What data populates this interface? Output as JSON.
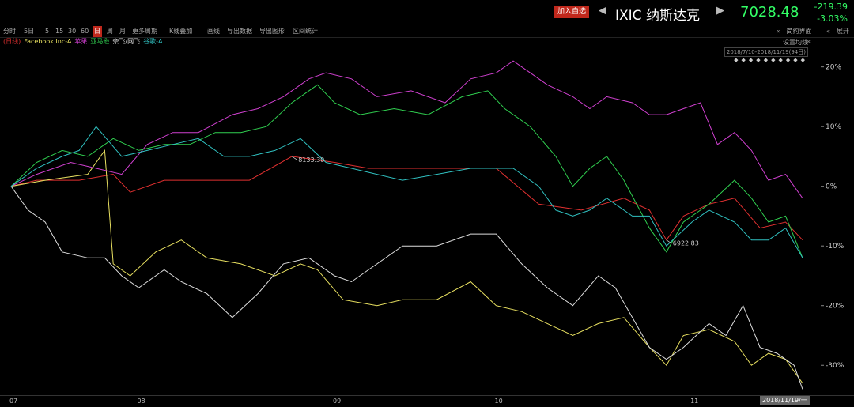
{
  "header": {
    "add_fav_label": "加入自选",
    "prev_arrow": "◀",
    "next_arrow": "▶",
    "stock_name": "IXIC 纳斯达克",
    "price": "7028.48",
    "change_abs": "-219.39",
    "change_pct": "-3.03%",
    "accent_red": "#c0281c",
    "up_green": "#33ff66"
  },
  "toolbar": {
    "items": [
      "分时",
      "5日",
      "5",
      "15",
      "30",
      "60",
      "日",
      "周",
      "月",
      "更多周期",
      "K线叠加",
      "画线",
      "导出数据",
      "导出图形",
      "区间统计"
    ],
    "active": "日",
    "right_items": [
      "简约界面",
      "展开"
    ],
    "right_icons": [
      "«",
      "«"
    ]
  },
  "legend": [
    {
      "label": "(日线)",
      "color": "#e03030"
    },
    {
      "label": "Facebook Inc-A",
      "color": "#e8e060"
    },
    {
      "label": "苹果",
      "color": "#d040d0"
    },
    {
      "label": "亚马逊",
      "color": "#30d050"
    },
    {
      "label": "奈飞",
      "color": "#dddddd"
    },
    {
      "label": "/网飞",
      "color": "#dddddd"
    },
    {
      "label": "谷歌-A",
      "color": "#30c0c0"
    }
  ],
  "settings_label": "设置均线",
  "settings_close": "×",
  "range_label": "2018/7/10-2018/11/19(94日)",
  "markers": "◆◆◆◆◆◆◆◆◆◆",
  "cursor_date": "2018/11/19/一",
  "chart_data": {
    "type": "line",
    "ylim": [
      -35,
      23
    ],
    "y_ticks": [
      20,
      10,
      0,
      -10,
      -20,
      -30
    ],
    "y_tick_labels": [
      "20%",
      "10%",
      "0%",
      "-10%",
      "-20%",
      "-30%"
    ],
    "x_ticks": [
      {
        "i": 0,
        "label": "07"
      },
      {
        "i": 15,
        "label": "08"
      },
      {
        "i": 38,
        "label": "09"
      },
      {
        "i": 57,
        "label": "10"
      },
      {
        "i": 80,
        "label": "11"
      }
    ],
    "n_points": 94,
    "grid": false,
    "annotations": [
      {
        "series": "index",
        "i": 33,
        "text": "8133.30"
      },
      {
        "series": "index",
        "i": 77,
        "text": "6922.83"
      }
    ],
    "series": [
      {
        "name": "(日线)",
        "color": "#e03030",
        "key": "index",
        "points": [
          [
            0,
            0
          ],
          [
            3,
            1
          ],
          [
            8,
            1
          ],
          [
            12,
            2
          ],
          [
            14,
            -1
          ],
          [
            18,
            1
          ],
          [
            24,
            1
          ],
          [
            28,
            1
          ],
          [
            33,
            5
          ],
          [
            38,
            4
          ],
          [
            42,
            3
          ],
          [
            50,
            3
          ],
          [
            55,
            3
          ],
          [
            57,
            3
          ],
          [
            62,
            -3
          ],
          [
            67,
            -4
          ],
          [
            72,
            -2
          ],
          [
            75,
            -4
          ],
          [
            77,
            -9
          ],
          [
            79,
            -5
          ],
          [
            82,
            -3
          ],
          [
            85,
            -2
          ],
          [
            88,
            -7
          ],
          [
            91,
            -6
          ],
          [
            93,
            -9
          ]
        ]
      },
      {
        "name": "Facebook Inc-A",
        "color": "#e8e060",
        "key": "fb",
        "points": [
          [
            0,
            0
          ],
          [
            4,
            1
          ],
          [
            9,
            2
          ],
          [
            11,
            6
          ],
          [
            12,
            -13
          ],
          [
            14,
            -15
          ],
          [
            17,
            -11
          ],
          [
            20,
            -9
          ],
          [
            23,
            -12
          ],
          [
            27,
            -13
          ],
          [
            31,
            -15
          ],
          [
            34,
            -13
          ],
          [
            36,
            -14
          ],
          [
            39,
            -19
          ],
          [
            43,
            -20
          ],
          [
            46,
            -19
          ],
          [
            50,
            -19
          ],
          [
            54,
            -16
          ],
          [
            57,
            -20
          ],
          [
            60,
            -21
          ],
          [
            63,
            -23
          ],
          [
            66,
            -25
          ],
          [
            69,
            -23
          ],
          [
            72,
            -22
          ],
          [
            75,
            -27
          ],
          [
            77,
            -30
          ],
          [
            79,
            -25
          ],
          [
            82,
            -24
          ],
          [
            85,
            -26
          ],
          [
            87,
            -30
          ],
          [
            89,
            -28
          ],
          [
            91,
            -29
          ],
          [
            93,
            -33
          ]
        ]
      },
      {
        "name": "苹果",
        "color": "#d040d0",
        "key": "apple",
        "points": [
          [
            0,
            0
          ],
          [
            3,
            2
          ],
          [
            7,
            4
          ],
          [
            10,
            3
          ],
          [
            13,
            2
          ],
          [
            16,
            7
          ],
          [
            19,
            9
          ],
          [
            22,
            9
          ],
          [
            26,
            12
          ],
          [
            29,
            13
          ],
          [
            32,
            15
          ],
          [
            35,
            18
          ],
          [
            37,
            19
          ],
          [
            40,
            18
          ],
          [
            43,
            15
          ],
          [
            47,
            16
          ],
          [
            51,
            14
          ],
          [
            54,
            18
          ],
          [
            57,
            19
          ],
          [
            59,
            21
          ],
          [
            61,
            19
          ],
          [
            63,
            17
          ],
          [
            66,
            15
          ],
          [
            68,
            13
          ],
          [
            70,
            15
          ],
          [
            73,
            14
          ],
          [
            75,
            12
          ],
          [
            77,
            12
          ],
          [
            79,
            13
          ],
          [
            81,
            14
          ],
          [
            83,
            7
          ],
          [
            85,
            9
          ],
          [
            87,
            6
          ],
          [
            89,
            1
          ],
          [
            91,
            2
          ],
          [
            93,
            -2
          ]
        ]
      },
      {
        "name": "亚马逊",
        "color": "#30d050",
        "key": "amzn",
        "points": [
          [
            0,
            0
          ],
          [
            3,
            4
          ],
          [
            6,
            6
          ],
          [
            9,
            5
          ],
          [
            12,
            8
          ],
          [
            15,
            6
          ],
          [
            18,
            7
          ],
          [
            21,
            7
          ],
          [
            24,
            9
          ],
          [
            27,
            9
          ],
          [
            30,
            10
          ],
          [
            33,
            14
          ],
          [
            36,
            17
          ],
          [
            38,
            14
          ],
          [
            41,
            12
          ],
          [
            45,
            13
          ],
          [
            49,
            12
          ],
          [
            53,
            15
          ],
          [
            56,
            16
          ],
          [
            58,
            13
          ],
          [
            61,
            10
          ],
          [
            64,
            5
          ],
          [
            66,
            0
          ],
          [
            68,
            3
          ],
          [
            70,
            5
          ],
          [
            72,
            1
          ],
          [
            75,
            -7
          ],
          [
            77,
            -11
          ],
          [
            79,
            -6
          ],
          [
            82,
            -3
          ],
          [
            85,
            1
          ],
          [
            87,
            -2
          ],
          [
            89,
            -6
          ],
          [
            91,
            -5
          ],
          [
            93,
            -12
          ]
        ]
      },
      {
        "name": "奈飞/网飞",
        "color": "#dddddd",
        "key": "nflx",
        "points": [
          [
            0,
            0
          ],
          [
            2,
            -4
          ],
          [
            4,
            -6
          ],
          [
            6,
            -11
          ],
          [
            9,
            -12
          ],
          [
            11,
            -12
          ],
          [
            13,
            -15
          ],
          [
            15,
            -17
          ],
          [
            18,
            -14
          ],
          [
            20,
            -16
          ],
          [
            23,
            -18
          ],
          [
            26,
            -22
          ],
          [
            29,
            -18
          ],
          [
            32,
            -13
          ],
          [
            35,
            -12
          ],
          [
            38,
            -15
          ],
          [
            40,
            -16
          ],
          [
            43,
            -13
          ],
          [
            46,
            -10
          ],
          [
            50,
            -10
          ],
          [
            54,
            -8
          ],
          [
            57,
            -8
          ],
          [
            60,
            -13
          ],
          [
            63,
            -17
          ],
          [
            66,
            -20
          ],
          [
            69,
            -15
          ],
          [
            71,
            -17
          ],
          [
            73,
            -22
          ],
          [
            75,
            -27
          ],
          [
            77,
            -29
          ],
          [
            79,
            -27
          ],
          [
            82,
            -23
          ],
          [
            84,
            -25
          ],
          [
            86,
            -20
          ],
          [
            88,
            -27
          ],
          [
            90,
            -28
          ],
          [
            92,
            -30
          ],
          [
            93,
            -34
          ]
        ]
      },
      {
        "name": "谷歌-A",
        "color": "#30c0c0",
        "key": "goog",
        "points": [
          [
            0,
            0
          ],
          [
            3,
            3
          ],
          [
            6,
            5
          ],
          [
            8,
            6
          ],
          [
            10,
            10
          ],
          [
            13,
            5
          ],
          [
            16,
            6
          ],
          [
            19,
            7
          ],
          [
            22,
            8
          ],
          [
            25,
            5
          ],
          [
            28,
            5
          ],
          [
            31,
            6
          ],
          [
            34,
            8
          ],
          [
            37,
            4
          ],
          [
            40,
            3
          ],
          [
            43,
            2
          ],
          [
            46,
            1
          ],
          [
            50,
            2
          ],
          [
            54,
            3
          ],
          [
            57,
            3
          ],
          [
            59,
            3
          ],
          [
            62,
            0
          ],
          [
            64,
            -4
          ],
          [
            66,
            -5
          ],
          [
            68,
            -4
          ],
          [
            70,
            -2
          ],
          [
            73,
            -5
          ],
          [
            75,
            -5
          ],
          [
            77,
            -10
          ],
          [
            80,
            -6
          ],
          [
            82,
            -4
          ],
          [
            85,
            -6
          ],
          [
            87,
            -9
          ],
          [
            89,
            -9
          ],
          [
            91,
            -7
          ],
          [
            93,
            -12
          ]
        ]
      }
    ]
  }
}
